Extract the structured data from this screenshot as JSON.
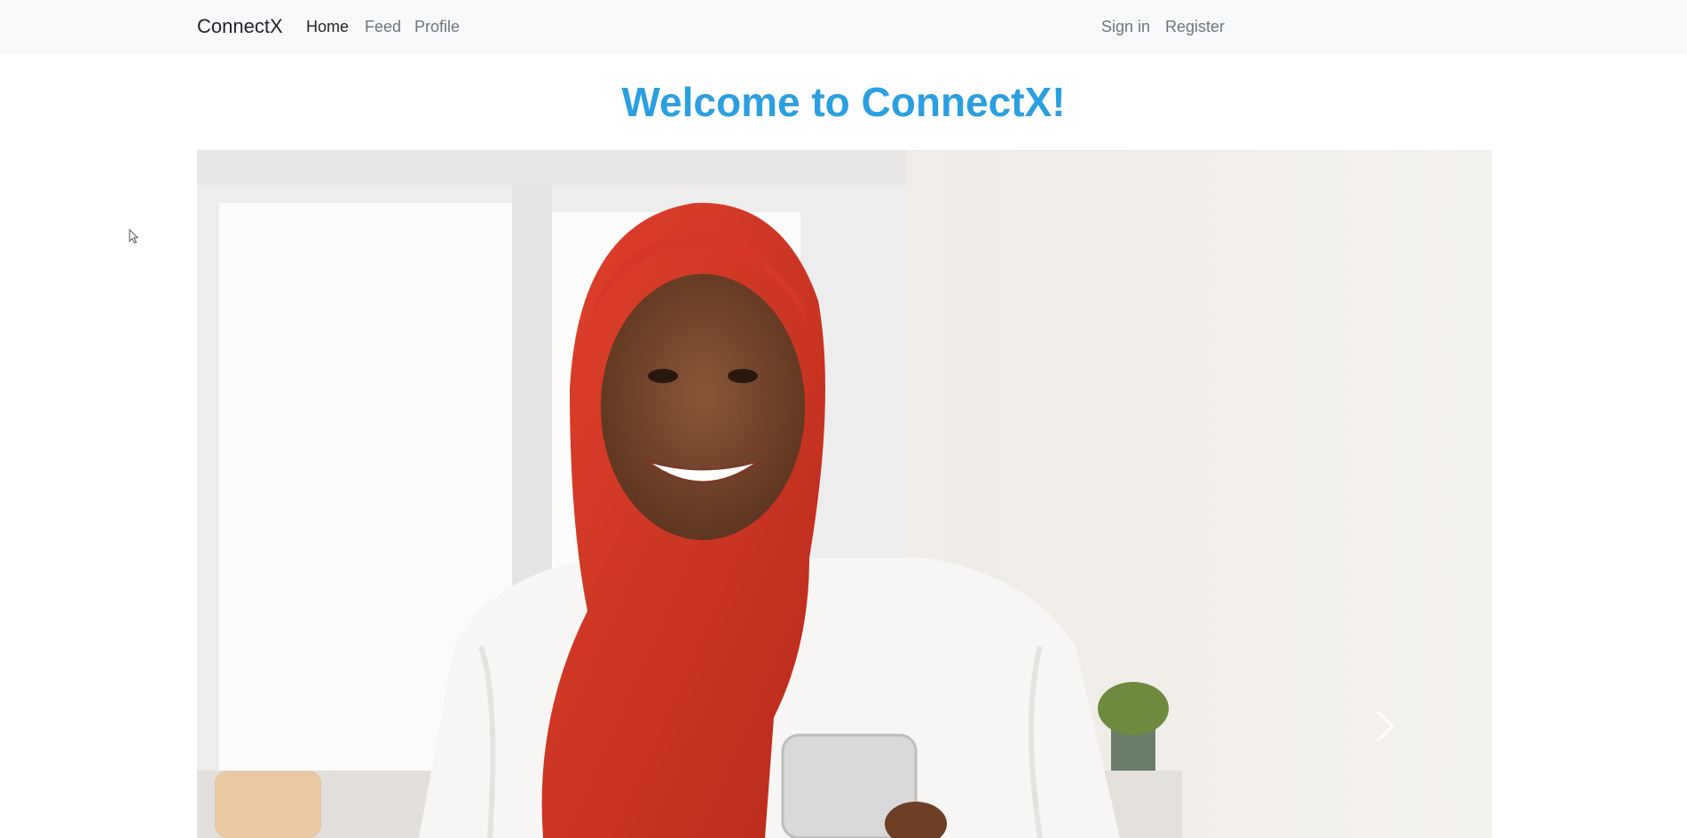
{
  "navbar": {
    "brand": "ConnectX",
    "links": [
      {
        "label": "Home",
        "active": true
      },
      {
        "label": "Feed",
        "active": false
      },
      {
        "label": "Profile",
        "active": false
      }
    ],
    "auth": [
      {
        "label": "Sign in"
      },
      {
        "label": "Register"
      }
    ]
  },
  "main": {
    "heading": "Welcome to ConnectX!",
    "carousel": {
      "next_icon": "chevron-right-icon"
    }
  },
  "colors": {
    "accent": "#2b9fe0",
    "navbar_bg": "#f8f9fa",
    "text_dark": "#212529",
    "text_muted": "#6c757d"
  }
}
